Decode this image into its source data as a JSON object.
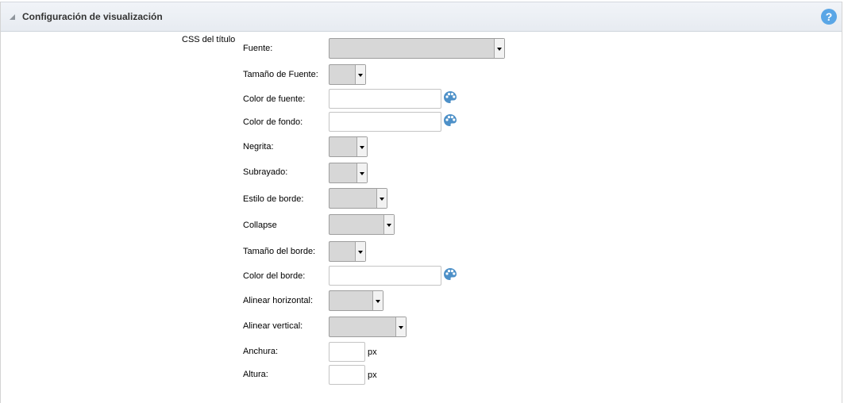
{
  "section": {
    "title": "Configuración de visualización",
    "help": "?"
  },
  "group_label": "CSS del título",
  "fields": {
    "fuente": "Fuente:",
    "tamano_fuente": "Tamaño de Fuente:",
    "color_fuente": "Color de fuente:",
    "color_fondo": "Color de fondo:",
    "negrita": "Negrita:",
    "subrayado": "Subrayado:",
    "estilo_borde": "Estilo de borde:",
    "collapse": "Collapse",
    "tamano_borde": "Tamaño del borde:",
    "color_borde": "Color del borde:",
    "alinear_horizontal": "Alinear horizontal:",
    "alinear_vertical": "Alinear vertical:",
    "anchura": "Anchura:",
    "altura": "Altura:"
  },
  "units": {
    "px": "px"
  },
  "icons": {
    "collapse": "triangle-collapse-icon",
    "help": "question-mark-icon",
    "color_picker": "palette-icon"
  },
  "colors": {
    "help_blue": "#5aa6e6",
    "header_bg": "#eaeef3"
  }
}
